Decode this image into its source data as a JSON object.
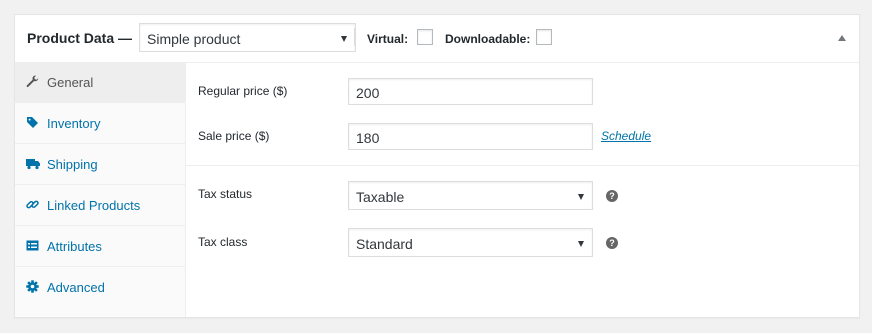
{
  "header": {
    "title": "Product Data —",
    "product_type": "Simple product",
    "virtual_label": "Virtual:",
    "downloadable_label": "Downloadable:"
  },
  "tabs": [
    {
      "label": "General",
      "icon": "wrench-icon",
      "active": true
    },
    {
      "label": "Inventory",
      "icon": "tag-icon",
      "active": false
    },
    {
      "label": "Shipping",
      "icon": "truck-icon",
      "active": false
    },
    {
      "label": "Linked Products",
      "icon": "link-icon",
      "active": false
    },
    {
      "label": "Attributes",
      "icon": "list-icon",
      "active": false
    },
    {
      "label": "Advanced",
      "icon": "gear-icon",
      "active": false
    }
  ],
  "general": {
    "regular_price_label": "Regular price ($)",
    "regular_price_value": "200",
    "sale_price_label": "Sale price ($)",
    "sale_price_value": "180",
    "schedule_link": "Schedule",
    "tax_status_label": "Tax status",
    "tax_status_value": "Taxable",
    "tax_class_label": "Tax class",
    "tax_class_value": "Standard",
    "help_glyph": "?"
  },
  "colors": {
    "link": "#0073aa",
    "active_tab_bg": "#eeeeee",
    "tab_bg": "#fafafa",
    "border": "#dddddd"
  }
}
